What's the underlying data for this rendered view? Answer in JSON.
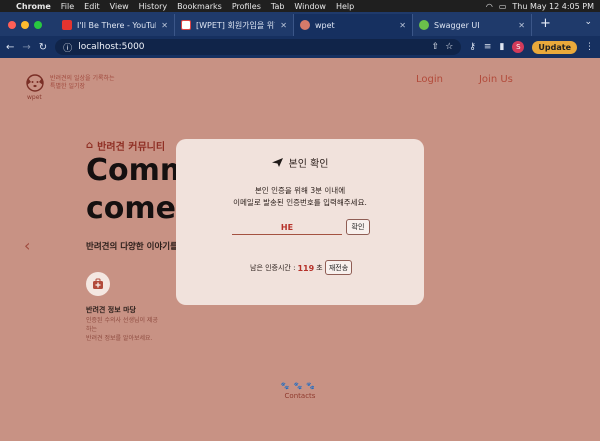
{
  "menubar": {
    "app": "Chrome",
    "items": [
      "File",
      "Edit",
      "View",
      "History",
      "Bookmarks",
      "Profiles",
      "Tab",
      "Window",
      "Help"
    ],
    "clock": "Thu May 12  4:05 PM"
  },
  "browser": {
    "tabs": [
      {
        "title": "I'll Be There - YouTube M",
        "favicon_color": "#e3342f",
        "favicon": "youtube-icon"
      },
      {
        "title": "[WPET] 회원가입을 위한 인증번",
        "favicon_color": "#ffffff",
        "favicon": "gmail-icon"
      },
      {
        "title": "wpet",
        "favicon_color": "#d67a6a",
        "favicon": "wpet-icon",
        "active": true
      },
      {
        "title": "Swagger UI",
        "favicon_color": "#6bc04b",
        "favicon": "swagger-icon"
      }
    ],
    "url": "localhost:5000",
    "profile_initial": "S",
    "update_label": "Update"
  },
  "site": {
    "tagline_line1": "반려견의 일상을 기록하는",
    "tagline_line2": "특별한 일기장",
    "brand": "wpet",
    "nav": {
      "login": "Login",
      "join": "Join Us"
    },
    "section_label": "반려견 커뮤니티",
    "hero_line1": "Commu",
    "hero_line2": "comes",
    "subtitle": "반려견의 다양한 이야기를",
    "feature_title": "반려견 정보 마당",
    "feature_desc_1": "인증된 수의사 선생님이 제공",
    "feature_desc_2": "하는",
    "feature_desc_3": "반려견 정보를 알아보세요.",
    "contacts": "Contacts"
  },
  "modal": {
    "title": "본인 확인",
    "desc_line1": "본인 인증을 위해 3분 이내에",
    "desc_line2": "이메일로 발송된 인증번호를 입력해주세요.",
    "code_value": "HE",
    "confirm_label": "확인",
    "timer_label": "남은 인증시간 :",
    "timer_seconds": "119",
    "timer_unit": "초",
    "resend_label": "재전송"
  },
  "colors": {
    "page_bg": "#c89284",
    "accent": "#b6322a",
    "modal_bg": "#f1e2dc"
  }
}
